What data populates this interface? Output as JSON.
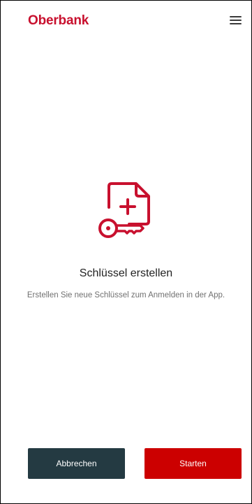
{
  "header": {
    "logo_text": "Oberbank",
    "menu_icon": "hamburger-menu-icon"
  },
  "main": {
    "icon": "document-key-add-icon",
    "title": "Schlüssel erstellen",
    "description": "Erstellen Sie neue Schlüssel zum Anmelden in der App."
  },
  "actions": {
    "cancel_label": "Abbrechen",
    "start_label": "Starten"
  },
  "colors": {
    "brand_red": "#c8102e",
    "primary_button": "#cc0000",
    "secondary_button": "#243a42"
  }
}
